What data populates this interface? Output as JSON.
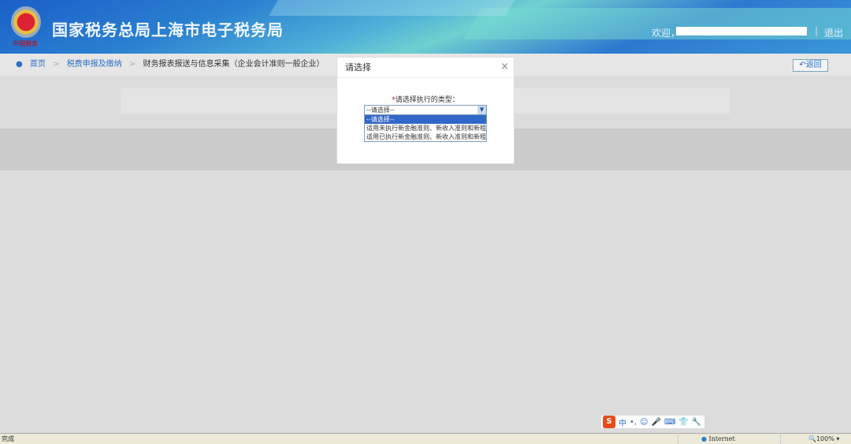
{
  "header": {
    "title": "国家税务总局上海市电子税务局",
    "logo_text": "中国税务",
    "welcome": "欢迎，",
    "separator": "|",
    "logout": "退出"
  },
  "breadcrumb": {
    "items": [
      "首页",
      "税费申报及缴纳",
      "财务报表报送与信息采集（企业会计准则一般企业）"
    ],
    "arrow": ">"
  },
  "back_button": "返回",
  "modal": {
    "title": "请选择",
    "close": "×",
    "required_mark": "*",
    "label": "请选择执行的类型：",
    "select_value": "--请选择--",
    "options": [
      "--请选择--",
      "适用未执行新金融准则、新收入准则和新租赁准则",
      "适用已执行新金融准则、新收入准则和新租赁准则"
    ]
  },
  "ime": {
    "logo": "S",
    "mode": "中",
    "punct": "•,",
    "emoji": "☺",
    "voice": "🎤",
    "keyboard": "⌨",
    "skin": "👕",
    "tools": "🔧"
  },
  "statusbar": {
    "status": "完成",
    "zone": "Internet",
    "zoom": "100%"
  }
}
